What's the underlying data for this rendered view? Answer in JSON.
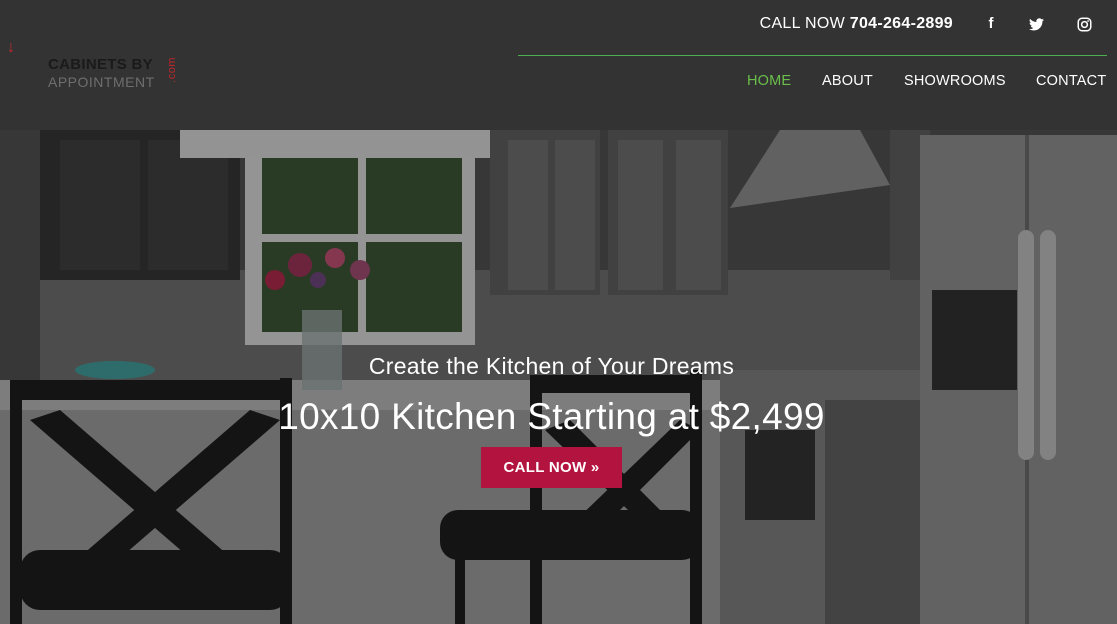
{
  "header": {
    "logo": {
      "line1": "CABINETS BY",
      "line2": "APPOINTMENT",
      "suffix": ".com"
    },
    "call": {
      "prefix": "CALL NOW",
      "phone": "704-264-2899"
    },
    "social": [
      {
        "icon": "facebook-icon",
        "glyph": "f"
      },
      {
        "icon": "twitter-icon",
        "glyph": "t"
      },
      {
        "icon": "instagram-icon",
        "glyph": "◎"
      }
    ],
    "nav": [
      {
        "label": "HOME",
        "active": true
      },
      {
        "label": "ABOUT",
        "active": false
      },
      {
        "label": "SHOWROOMS",
        "active": false
      },
      {
        "label": "CONTACT",
        "active": false
      }
    ]
  },
  "hero": {
    "subtitle": "Create the Kitchen of Your Dreams",
    "title": "10x10 Kitchen Starting at $2,499",
    "cta_label": "CALL NOW »"
  },
  "colors": {
    "header_bg": "#333333",
    "accent_green": "#6abf4b",
    "cta": "#b3133f",
    "logo_red": "#c0272d"
  }
}
